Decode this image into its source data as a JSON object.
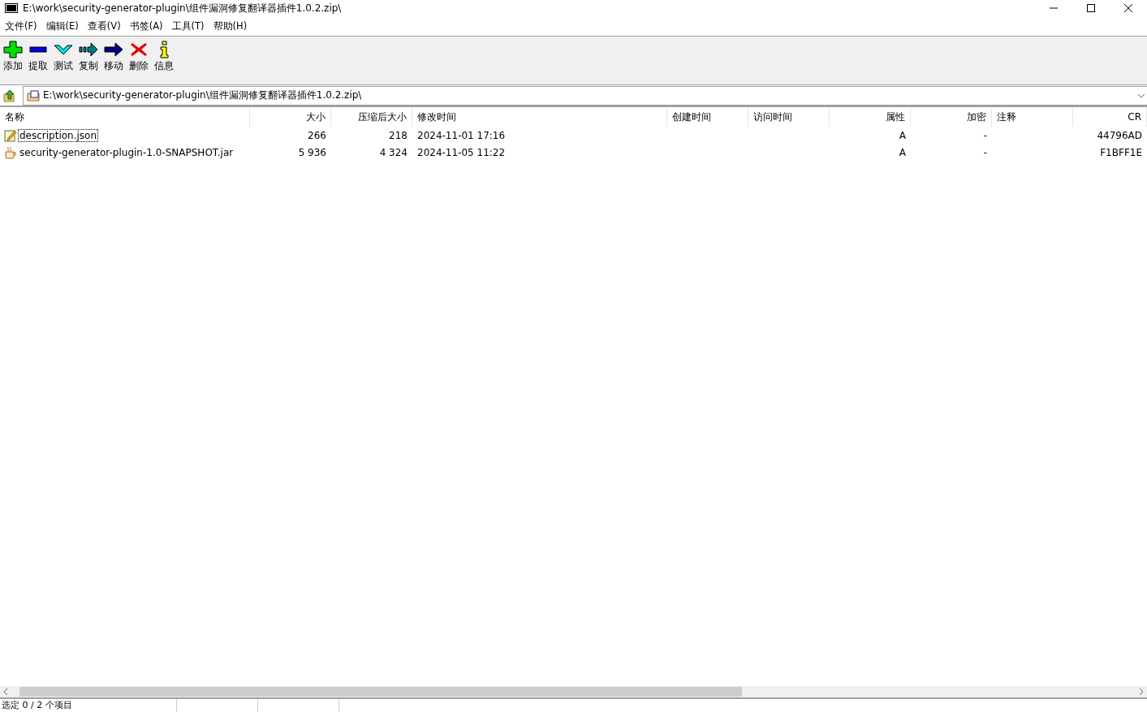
{
  "window": {
    "title": "E:\\work\\security-generator-plugin\\组件漏洞修复翻译器插件1.0.2.zip\\"
  },
  "menu": [
    "文件(F)",
    "编辑(E)",
    "查看(V)",
    "书签(A)",
    "工具(T)",
    "帮助(H)"
  ],
  "toolbar": [
    {
      "kind": "add",
      "label": "添加"
    },
    {
      "kind": "extract",
      "label": "提取"
    },
    {
      "kind": "test",
      "label": "测试"
    },
    {
      "kind": "copy",
      "label": "复制"
    },
    {
      "kind": "move",
      "label": "移动"
    },
    {
      "kind": "delete",
      "label": "删除"
    },
    {
      "kind": "info",
      "label": "信息"
    }
  ],
  "address": {
    "value": "E:\\work\\security-generator-plugin\\组件漏洞修复翻译器插件1.0.2.zip\\"
  },
  "table": {
    "columns": [
      "名称",
      "大小",
      "压缩后大小",
      "修改时间",
      "创建时间",
      "访问时间",
      "属性",
      "加密",
      "注释",
      "CR"
    ],
    "rows": [
      {
        "kind": "json",
        "focused": true,
        "cells": [
          "description.json",
          "266",
          "218",
          "2024-11-01 17:16",
          "",
          "",
          "A",
          "-",
          "",
          "44796AD"
        ]
      },
      {
        "kind": "jar",
        "focused": false,
        "cells": [
          "security-generator-plugin-1.0-SNAPSHOT.jar",
          "5 936",
          "4 324",
          "2024-11-05 11:22",
          "",
          "",
          "A",
          "-",
          "",
          "F1BFF1E"
        ]
      }
    ]
  },
  "status_bar": [
    "选定 0 / 2 个项目"
  ]
}
